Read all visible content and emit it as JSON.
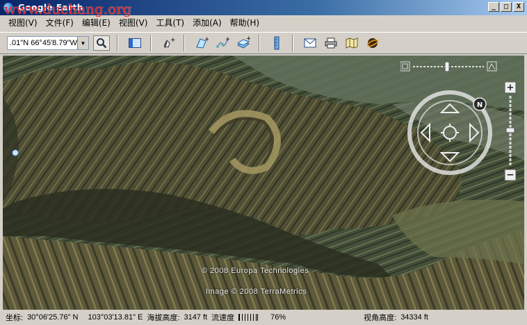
{
  "window": {
    "title": "Google Earth",
    "watermark": "www.duchang.org",
    "buttons": [
      "_",
      "□",
      "X"
    ]
  },
  "menu": [
    "视图(V)",
    "文件(F)",
    "编辑(E)",
    "视图(V)",
    "工具(T)",
    "添加(A)",
    "帮助(H)"
  ],
  "toolbar": {
    "coordinate_value": ".01\"N 66°45'8.79\"W",
    "icons": [
      "search-icon",
      "sidebar-icon",
      "placemark-icon",
      "polygon-icon",
      "path-icon",
      "image-overlay-icon",
      "ruler-icon",
      "email-icon",
      "print-icon",
      "map-icon",
      "sky-icon"
    ]
  },
  "map": {
    "credits": {
      "europa": "© 2008 Europa Technologies",
      "terrametrics": "Image © 2008 TerraMetrics"
    },
    "compass_label": "N"
  },
  "status": {
    "pointer_label": "坐标:",
    "lat": "30°06'25.76\" N",
    "lon": "103°03'13.81\" E",
    "elevation_label": "海拔高度:",
    "elevation": "3147 ft",
    "streaming_label": "流速度",
    "streaming_pct": "76%",
    "eye_label": "视角高度:",
    "eye_alt": "34334 ft"
  }
}
